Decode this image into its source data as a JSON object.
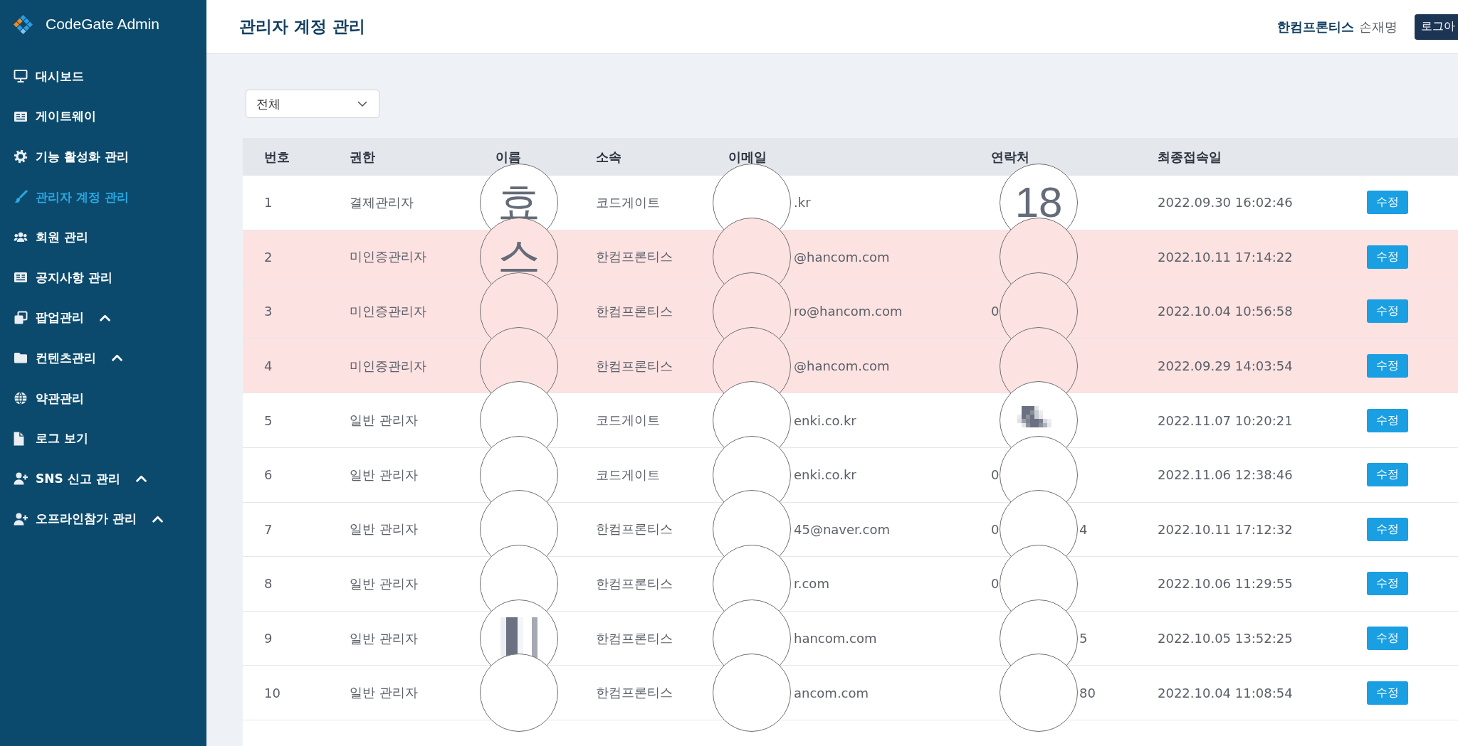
{
  "sidebar": {
    "logo": {
      "title": "CodeGate Admin"
    },
    "items": [
      {
        "label": "대시보드",
        "selected": false,
        "has_submenu": false
      },
      {
        "label": "게이트웨이",
        "selected": false,
        "has_submenu": false
      },
      {
        "label": "기능 활성화 관리",
        "selected": false,
        "has_submenu": false
      },
      {
        "label": "관리자 계정 관리",
        "selected": true,
        "has_submenu": false
      },
      {
        "label": "회원 관리",
        "selected": false,
        "has_submenu": false
      },
      {
        "label": "공지사항 관리",
        "selected": false,
        "has_submenu": false
      },
      {
        "label": "팝업관리",
        "selected": false,
        "has_submenu": true
      },
      {
        "label": "컨텐츠관리",
        "selected": false,
        "has_submenu": true
      },
      {
        "label": "약관관리",
        "selected": false,
        "has_submenu": false
      },
      {
        "label": "로그 보기",
        "selected": false,
        "has_submenu": false
      },
      {
        "label": "SNS 신고 관리",
        "selected": false,
        "has_submenu": true
      },
      {
        "label": "오프라인참가 관리",
        "selected": false,
        "has_submenu": true
      }
    ]
  },
  "header": {
    "title": "관리자 계정 관리",
    "company": "한컴프론티스",
    "user": "손재명",
    "logout_button": "로그아"
  },
  "filter": {
    "value": "전체"
  },
  "table": {
    "columns": [
      "번호",
      "권한",
      "이름",
      "소속",
      "이메일",
      "연락처",
      "최종접속일"
    ],
    "rows": [
      {
        "number": "1",
        "role": "결제관리자",
        "redacted": true,
        "name_magnified": "효",
        "organization": "코드게이트",
        "email_tail": ".kr",
        "phone_magnified": "18",
        "last_login": "2022.09.30 16:02:46",
        "action": "수정",
        "highlighted": false
      },
      {
        "number": "2",
        "role": "미인증관리자",
        "redacted": true,
        "name_magnified": "스",
        "organization": "한컴프론티스",
        "email_tail": "@hancom.com",
        "last_login": "2022.10.11 17:14:22",
        "action": "수정",
        "highlighted": true
      },
      {
        "number": "3",
        "role": "미인증관리자",
        "redacted": true,
        "organization": "한컴프론티스",
        "email_tail": "ro@hancom.com",
        "phone_head": "0",
        "last_login": "2022.10.04 10:56:58",
        "action": "수정",
        "highlighted": true
      },
      {
        "number": "4",
        "role": "미인증관리자",
        "redacted": true,
        "organization": "한컴프론티스",
        "email_tail": "@hancom.com",
        "last_login": "2022.09.29 14:03:54",
        "action": "수정",
        "highlighted": true
      },
      {
        "number": "5",
        "role": "일반 관리자",
        "redacted": true,
        "organization": "코드게이트",
        "email_tail": "enki.co.kr",
        "phone_pixelated": true,
        "last_login": "2022.11.07 10:20:21",
        "action": "수정",
        "highlighted": false
      },
      {
        "number": "6",
        "role": "일반 관리자",
        "redacted": true,
        "organization": "코드게이트",
        "email_tail": "enki.co.kr",
        "phone_head": "0",
        "last_login": "2022.11.06 12:38:46",
        "action": "수정",
        "highlighted": false
      },
      {
        "number": "7",
        "role": "일반 관리자",
        "redacted": true,
        "organization": "한컴프론티스",
        "email_tail": "45@naver.com",
        "phone_head": "0",
        "phone_tail": "4",
        "last_login": "2022.10.11 17:12:32",
        "action": "수정",
        "highlighted": false
      },
      {
        "number": "8",
        "role": "일반 관리자",
        "redacted": true,
        "organization": "한컴프론티스",
        "email_tail": "r.com",
        "phone_head": "0",
        "last_login": "2022.10.06 11:29:55",
        "action": "수정",
        "highlighted": false
      },
      {
        "number": "9",
        "role": "일반 관리자",
        "redacted": true,
        "name_pixelated": true,
        "organization": "한컴프론티스",
        "email_tail": "hancom.com",
        "phone_tail": "5",
        "last_login": "2022.10.05 13:52:25",
        "action": "수정",
        "highlighted": false
      },
      {
        "number": "10",
        "role": "일반 관리자",
        "redacted": true,
        "organization": "한컴프론티스",
        "email_tail": "ancom.com",
        "phone_tail": "80",
        "last_login": "2022.10.04 11:08:54",
        "action": "수정",
        "highlighted": false
      }
    ]
  }
}
